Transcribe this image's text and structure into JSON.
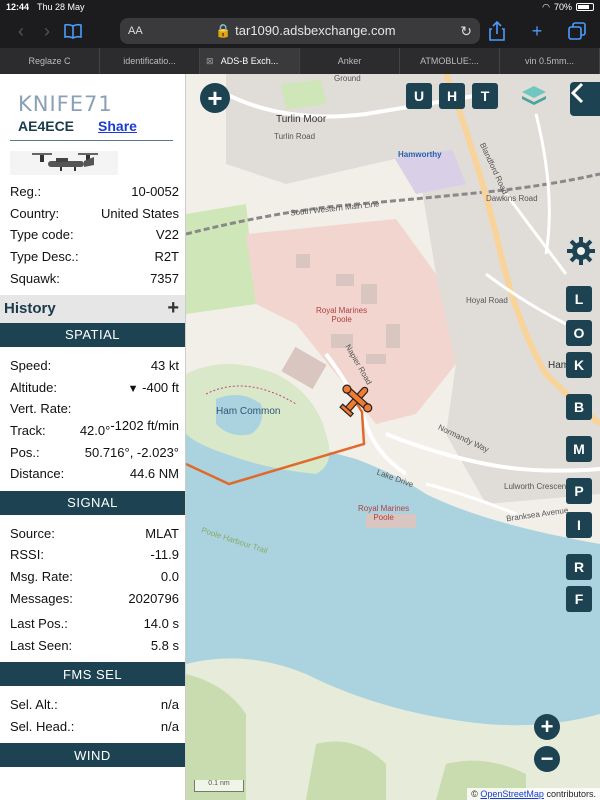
{
  "status": {
    "time": "12:44",
    "date": "Thu 28 May",
    "battery": "70%"
  },
  "browser": {
    "text_size": "AA",
    "url": "tar1090.adsbexchange.com",
    "tabs": [
      "Reglaze C",
      "identificatio...",
      "ADS-B Exch...",
      "Anker",
      "ATMOBLUE:...",
      "vin 0.5mm..."
    ],
    "active_tab": 2
  },
  "aircraft": {
    "callsign": "KNIFE71",
    "hex": "AE4ECE",
    "share_label": "Share",
    "details": [
      {
        "label": "Reg.:",
        "value": "10-0052"
      },
      {
        "label": "Country:",
        "value": "United States"
      },
      {
        "label": "Type code:",
        "value": "V22"
      },
      {
        "label": "Type Desc.:",
        "value": "R2T"
      },
      {
        "label": "Squawk:",
        "value": "7357"
      }
    ]
  },
  "history_label": "History",
  "spatial": {
    "title": "SPATIAL",
    "speed_label": "Speed:",
    "speed": "43 kt",
    "altitude_label": "Altitude:",
    "altitude": "-400 ft",
    "vert_rate_label": "Vert. Rate:",
    "vert_rate": "-1202 ft/min",
    "track_label": "Track:",
    "track": "42.0°",
    "pos_label": "Pos.:",
    "pos": "50.716°, -2.023°",
    "distance_label": "Distance:",
    "distance": "44.6 NM"
  },
  "signal": {
    "title": "SIGNAL",
    "source_label": "Source:",
    "source": "MLAT",
    "rssi_label": "RSSI:",
    "rssi": "-11.9",
    "msg_rate_label": "Msg. Rate:",
    "msg_rate": "0.0",
    "messages_label": "Messages:",
    "messages": "2020796",
    "last_pos_label": "Last Pos.:",
    "last_pos": "14.0 s",
    "last_seen_label": "Last Seen:",
    "last_seen": "5.8 s"
  },
  "fms": {
    "title": "FMS SEL",
    "sel_alt_label": "Sel. Alt.:",
    "sel_alt": "n/a",
    "sel_head_label": "Sel. Head.:",
    "sel_head": "n/a"
  },
  "wind_title": "WIND",
  "map": {
    "labels": {
      "turlin_moor": "Turlin Moor",
      "turlin_road": "Turlin Road",
      "hamworthy": "Hamworthy",
      "royal_marines": "Royal Marines",
      "poole": "Poole",
      "ham_common": "Ham Common",
      "napier_road": "Napier Road",
      "blandford_road": "Blandford Road",
      "south_western": "South Western Main Line",
      "hamwo": "Hamwo",
      "royal_marines_2": "Royal Marines",
      "poole_2": "Poole",
      "lake_drive": "Lake Drive",
      "lulworth": "Lulworth Crescent",
      "branksea": "Branksea Avenue",
      "gr": "Ground",
      "harbour_walk": "Poole Harbour Trail",
      "dawkins": "Dawkins Road",
      "hoyal": "Hoyal Road",
      "normandy": "Normandy Way"
    },
    "header_buttons": [
      "U",
      "H",
      "T"
    ],
    "side_buttons": [
      "L",
      "O",
      "K",
      "B",
      "M",
      "P",
      "I",
      "R",
      "F"
    ],
    "scale": "0.1 nm",
    "attribution_prefix": "©",
    "attribution_link": "OpenStreetMap",
    "attribution_suffix": "contributors."
  }
}
